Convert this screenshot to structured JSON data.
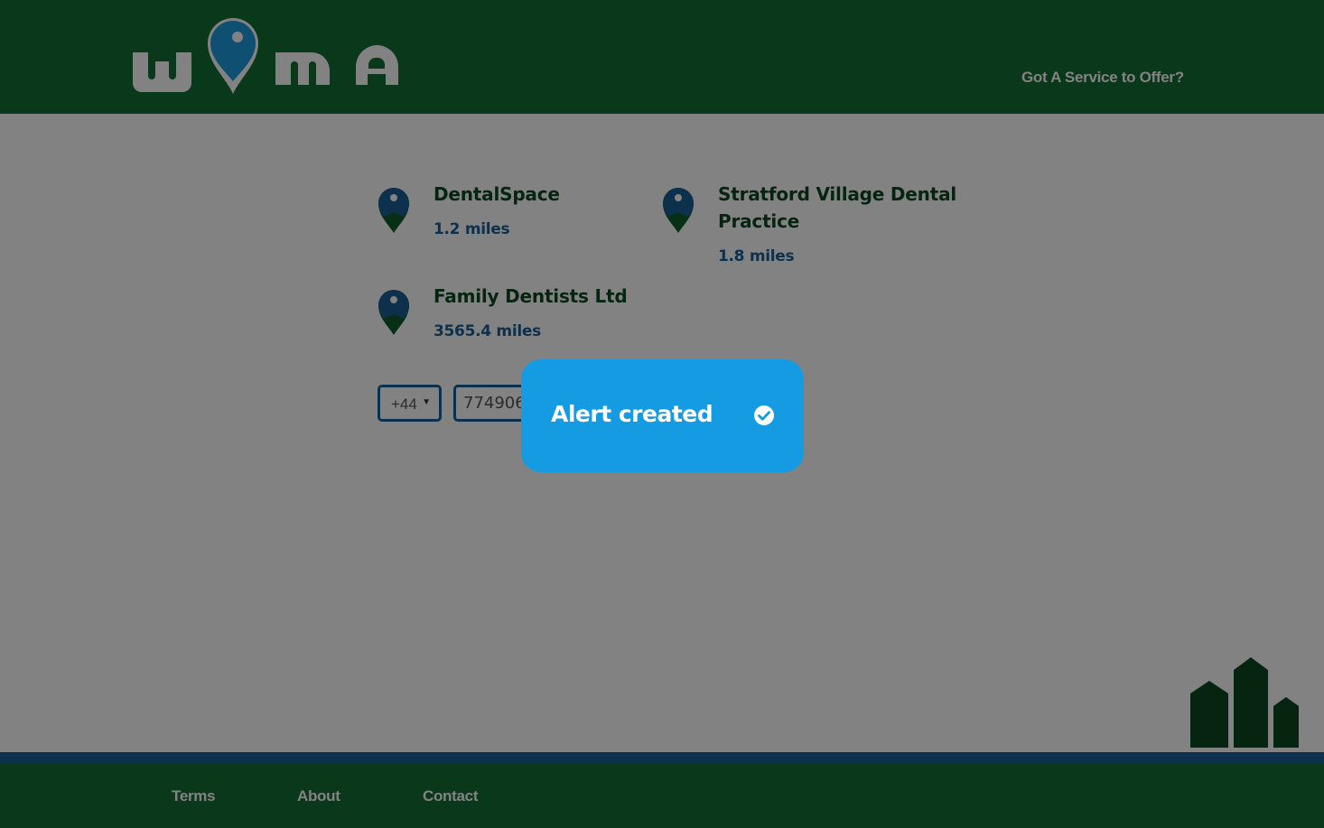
{
  "header": {
    "logo_text": "wyma",
    "service_link": "Got A Service to Offer?"
  },
  "results": [
    {
      "name": "DentalSpace",
      "distance": "1.2 miles",
      "icon": "map-pin-icon"
    },
    {
      "name": "Stratford Village Dental Practice",
      "distance": "1.8 miles",
      "icon": "map-pin-icon"
    },
    {
      "name": "Family Dentists Ltd",
      "distance": "3565.4 miles",
      "icon": "map-pin-icon"
    }
  ],
  "alert_form": {
    "country_code": "+44",
    "phone_value": "7749068"
  },
  "toast": {
    "message": "Alert created",
    "icon": "check-circle-icon"
  },
  "footer": {
    "terms": "Terms",
    "about": "About",
    "contact": "Contact"
  },
  "colors": {
    "header_green": "#126e33",
    "pin_blue": "#1a5f96",
    "name_green": "#0c4a21",
    "toast_blue": "#149be2",
    "logo_pin_blue": "#1e9be0"
  }
}
